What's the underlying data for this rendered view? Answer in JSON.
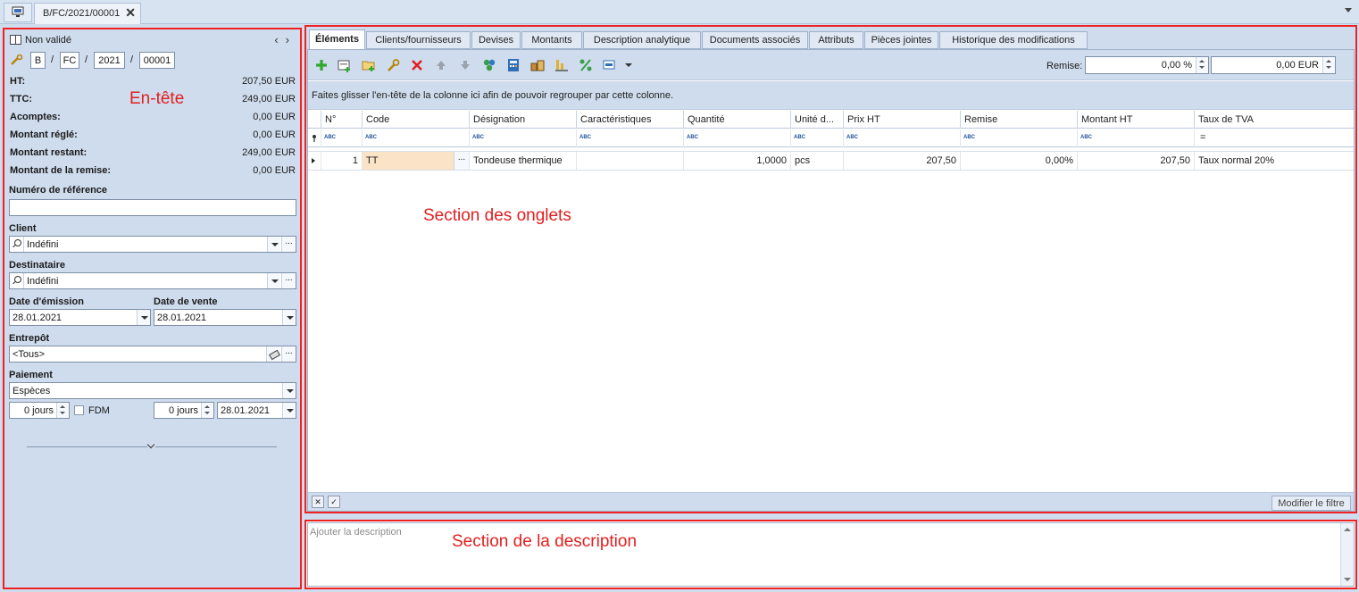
{
  "window": {
    "doc_tab_title": "B/FC/2021/00001",
    "doc_tab_close": "✕"
  },
  "header": {
    "status": "Non validé",
    "number": {
      "prefix": "B",
      "series": "FC",
      "year": "2021",
      "seq": "00001",
      "sep": "/"
    },
    "amounts": [
      {
        "label": "HT:",
        "value": "207,50 EUR"
      },
      {
        "label": "TTC:",
        "value": "249,00 EUR"
      },
      {
        "label": "Acomptes:",
        "value": "0,00 EUR"
      },
      {
        "label": "Montant réglé:",
        "value": "0,00 EUR"
      },
      {
        "label": "Montant restant:",
        "value": "249,00 EUR"
      },
      {
        "label": "Montant de la remise:",
        "value": "0,00 EUR"
      }
    ],
    "section_label": "En-tête",
    "ref_label": "Numéro de référence",
    "ref_value": "",
    "client_label": "Client",
    "client_value": "Indéfini",
    "dest_label": "Destinataire",
    "dest_value": "Indéfini",
    "issue_date_label": "Date d'émission",
    "issue_date": "28.01.2021",
    "sale_date_label": "Date de vente",
    "sale_date": "28.01.2021",
    "warehouse_label": "Entrepôt",
    "warehouse_value": "<Tous>",
    "payment_label": "Paiement",
    "payment_value": "Espèces",
    "days1": "0 jours",
    "fdm_label": "FDM",
    "days2": "0 jours",
    "due_date": "28.01.2021",
    "ellipsis": "..."
  },
  "tabs": [
    {
      "label": "Éléments",
      "active": true
    },
    {
      "label": "Clients/fournisseurs",
      "active": false
    },
    {
      "label": "Devises",
      "active": false
    },
    {
      "label": "Montants",
      "active": false
    },
    {
      "label": "Description analytique",
      "active": false
    },
    {
      "label": "Documents associés",
      "active": false
    },
    {
      "label": "Attributs",
      "active": false
    },
    {
      "label": "Pièces jointes",
      "active": false
    },
    {
      "label": "Historique des modifications",
      "active": false
    }
  ],
  "toolbar": {
    "icons": [
      "add-icon",
      "add-from-list-icon",
      "add-folder-icon",
      "edit-wrench-icon",
      "delete-icon",
      "move-up-icon",
      "move-down-icon",
      "cluster-icon",
      "calculator-icon",
      "stock-icon",
      "chart-icon",
      "percent-icon",
      "settings-dropdown-icon"
    ],
    "remise_label": "Remise:",
    "remise_percent": "0,00 %",
    "remise_amount": "0,00 EUR"
  },
  "grid": {
    "group_hint": "Faites glisser l'en-tête de la colonne ici afin de pouvoir regrouper par cette colonne.",
    "columns": [
      "N°",
      "Code",
      "Désignation",
      "Caractéristiques",
      "Quantité",
      "Unité d...",
      "Prix HT",
      "Remise",
      "Montant HT",
      "Taux de TVA"
    ],
    "filter_glyph": "ABC",
    "filter_eq": "=",
    "rows": [
      {
        "num": "1",
        "code": "TT",
        "designation": "Tondeuse thermique",
        "caracteristiques": "",
        "quantite": "1,0000",
        "unite": "pcs",
        "prix_ht": "207,50",
        "remise": "0,00%",
        "montant_ht": "207,50",
        "taux_tva": "Taux normal 20%"
      }
    ],
    "section_label": "Section des onglets",
    "footer_x": "✕",
    "footer_check": "✓",
    "modify_filter": "Modifier le filtre"
  },
  "splitter": "....",
  "description": {
    "placeholder": "Ajouter la description",
    "section_label": "Section de la description"
  },
  "colors": {
    "annotation_red": "#e02020",
    "panel_bg": "#cfdced",
    "code_cell_highlight": "#fbe3c8"
  }
}
